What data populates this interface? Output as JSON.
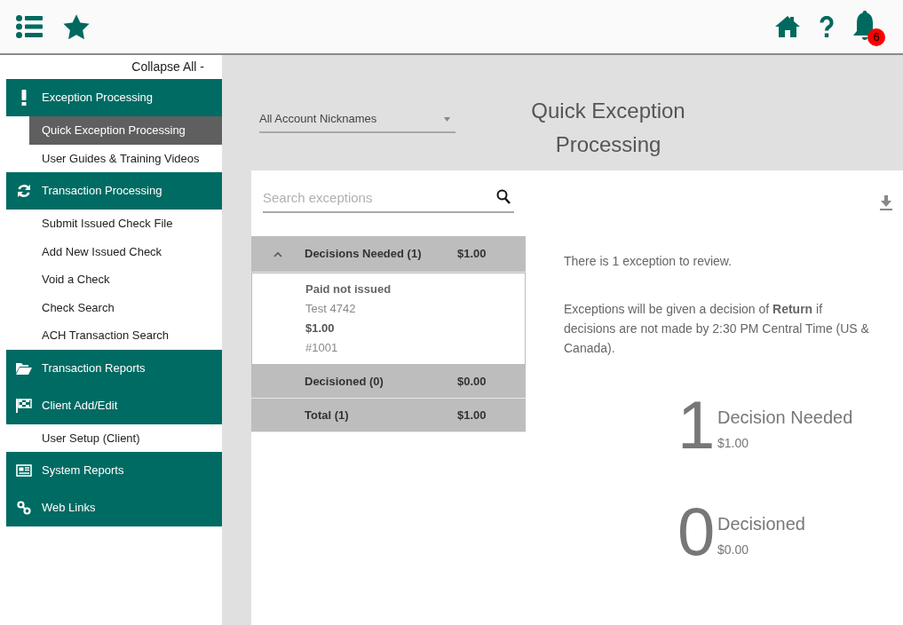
{
  "header": {
    "notification_count": "6"
  },
  "sidebar": {
    "collapse_label": "Collapse All -",
    "sections": [
      {
        "label": "Exception Processing",
        "items": [
          {
            "label": "Quick Exception Processing",
            "selected": true
          },
          {
            "label": "User Guides & Training Videos",
            "selected": false
          }
        ]
      },
      {
        "label": "Transaction Processing",
        "items": [
          {
            "label": "Submit Issued Check File",
            "selected": false
          },
          {
            "label": "Add New Issued Check",
            "selected": false
          },
          {
            "label": "Void a Check",
            "selected": false
          },
          {
            "label": "Check Search",
            "selected": false
          },
          {
            "label": "ACH Transaction Search",
            "selected": false
          }
        ]
      },
      {
        "label": "Transaction Reports"
      },
      {
        "label": "Client Add/Edit",
        "items": [
          {
            "label": "User Setup (Client)",
            "selected": false
          }
        ]
      },
      {
        "label": "System Reports"
      },
      {
        "label": "Web Links"
      }
    ]
  },
  "account_select": {
    "value": "All Account Nicknames"
  },
  "page_title": "Quick Exception Processing",
  "search": {
    "placeholder": "Search exceptions"
  },
  "groups": [
    {
      "label": "Decisions Needed (1)",
      "amount": "$1.00",
      "expanded": true,
      "items": [
        {
          "type": "Paid not issued",
          "name": "Test 4742",
          "amount": "$1.00",
          "number": "#1001"
        }
      ]
    },
    {
      "label": "Decisioned (0)",
      "amount": "$0.00",
      "expanded": false
    },
    {
      "label": "Total (1)",
      "amount": "$1.00",
      "expanded": false
    }
  ],
  "summary": {
    "message": "There is 1 exception to review.",
    "note": "Exceptions will be given a decision of **Return** if decisions are not made by 2:30 PM Central Time (US & Canada).",
    "stats": [
      {
        "count": "1",
        "label": "Decision Needed",
        "amount": "$1.00"
      },
      {
        "count": "0",
        "label": "Decisioned",
        "amount": "$0.00"
      }
    ]
  }
}
